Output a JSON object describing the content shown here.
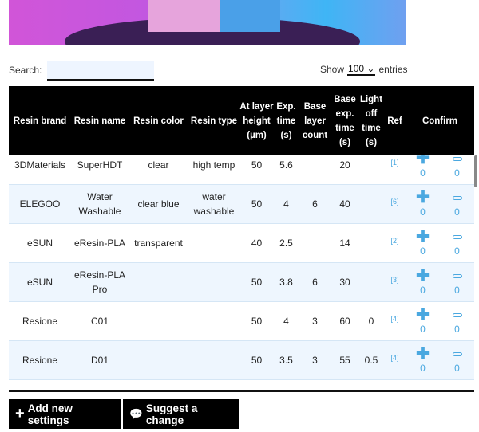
{
  "search": {
    "label": "Search:",
    "value": ""
  },
  "show": {
    "prefix": "Show",
    "value": "100",
    "suffix": "entries"
  },
  "headers": [
    "Resin brand",
    "Resin name",
    "Resin color",
    "Resin type",
    "At layer height (µm)",
    "Exp. time (s)",
    "Base layer count",
    "Base exp. time (s)",
    "Light off time (s)",
    "Ref",
    "Confirm"
  ],
  "rows": [
    {
      "brand": "3DMaterials",
      "name": "SuperHDT",
      "color": "clear",
      "type": "high temp",
      "layer": "50",
      "exp": "5.6",
      "base_count": "",
      "base_exp": "20",
      "light_off": "",
      "ref": "[1]",
      "up": "0",
      "down": "0"
    },
    {
      "brand": "ELEGOO",
      "name": "Water Washable",
      "color": "clear blue",
      "type": "water washable",
      "layer": "50",
      "exp": "4",
      "base_count": "6",
      "base_exp": "40",
      "light_off": "",
      "ref": "[6]",
      "up": "0",
      "down": "0"
    },
    {
      "brand": "eSUN",
      "name": "eResin-PLA",
      "color": "transparent",
      "type": "",
      "layer": "40",
      "exp": "2.5",
      "base_count": "",
      "base_exp": "14",
      "light_off": "",
      "ref": "[2]",
      "up": "0",
      "down": "0"
    },
    {
      "brand": "eSUN",
      "name": "eResin-PLA Pro",
      "color": "",
      "type": "",
      "layer": "50",
      "exp": "3.8",
      "base_count": "6",
      "base_exp": "30",
      "light_off": "",
      "ref": "[3]",
      "up": "0",
      "down": "0"
    },
    {
      "brand": "Resione",
      "name": "C01",
      "color": "",
      "type": "",
      "layer": "50",
      "exp": "4",
      "base_count": "3",
      "base_exp": "60",
      "light_off": "0",
      "ref": "[4]",
      "up": "0",
      "down": "0"
    },
    {
      "brand": "Resione",
      "name": "D01",
      "color": "",
      "type": "",
      "layer": "50",
      "exp": "3.5",
      "base_count": "3",
      "base_exp": "55",
      "light_off": "0.5",
      "ref": "[4]",
      "up": "0",
      "down": "0"
    }
  ],
  "buttons": {
    "add": "Add new settings",
    "suggest": "Suggest a change"
  },
  "colors": {
    "accent": "#4aa8e0",
    "header_bg": "#000000",
    "row_alt": "#eef6fe"
  }
}
